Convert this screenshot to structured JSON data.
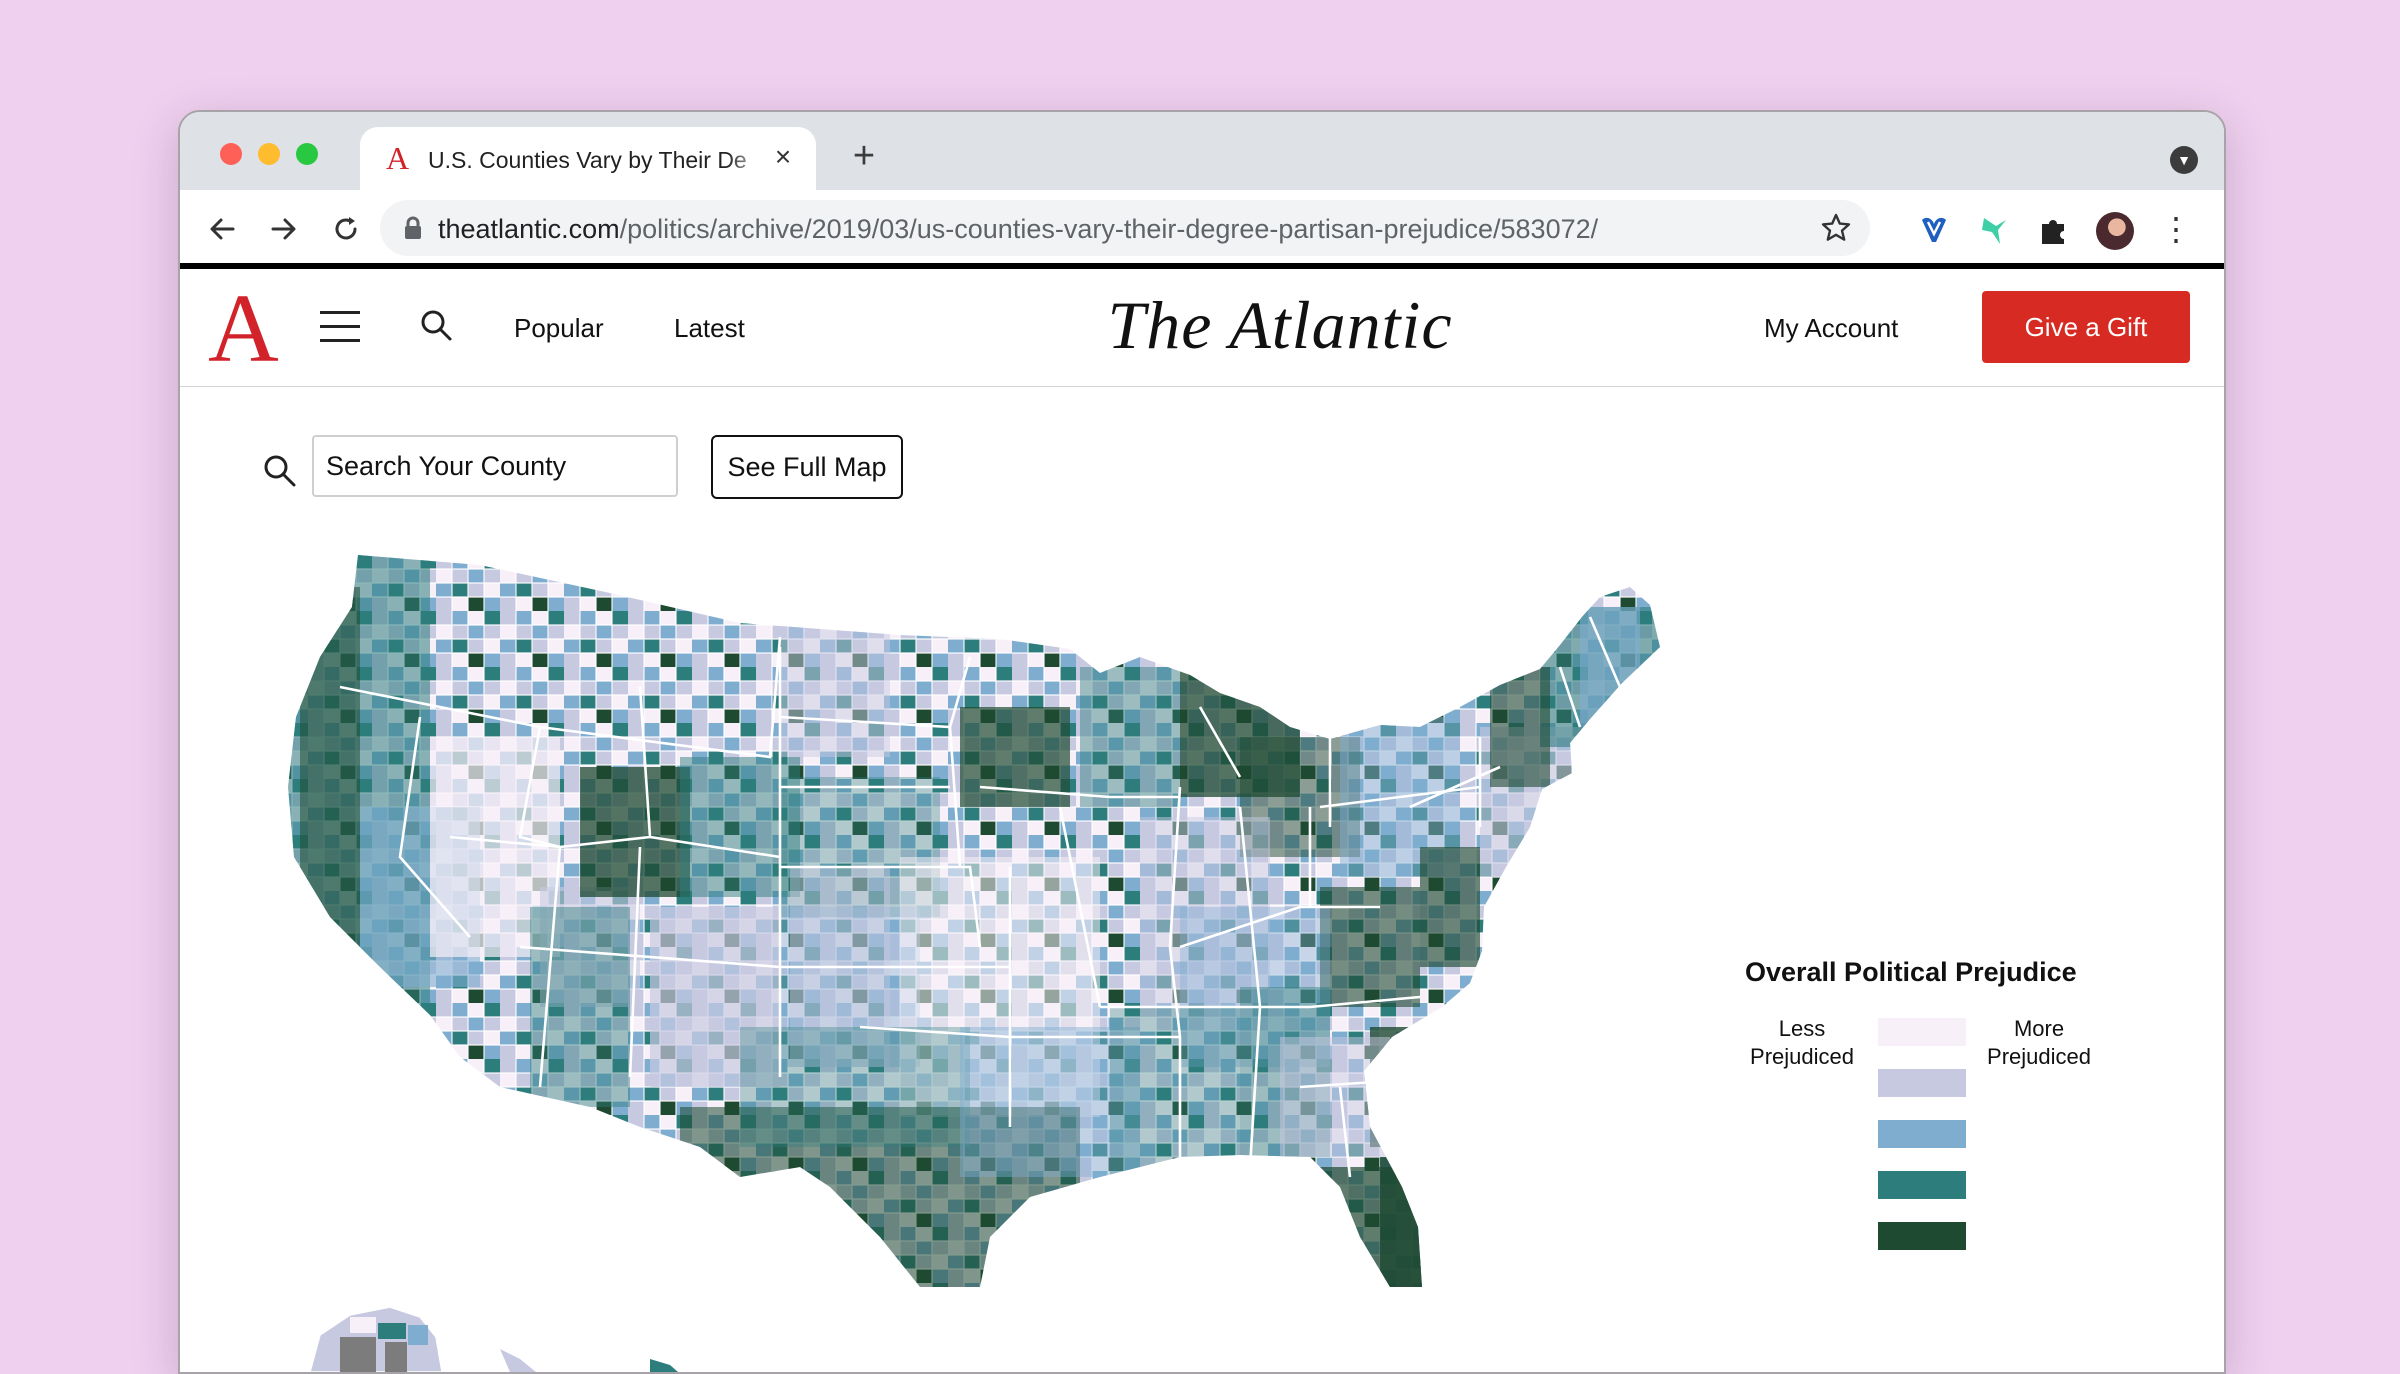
{
  "browser": {
    "tab_title": "U.S. Counties Vary by Their De",
    "tab_favicon": "A",
    "url_host": "theatlantic.com",
    "url_path": "/politics/archive/2019/03/us-counties-vary-their-degree-partisan-prejudice/583072/"
  },
  "header": {
    "brand_mark": "A",
    "nav": [
      "Popular",
      "Latest"
    ],
    "logo": "The Atlantic",
    "account": "My Account",
    "gift_button": "Give a Gift"
  },
  "map_controls": {
    "search_placeholder": "Search Your County",
    "full_map_button": "See Full Map"
  },
  "legend": {
    "title": "Overall Political Prejudice",
    "left_label": "Less Prejudiced",
    "right_label": "More Prejudiced",
    "colors": [
      "#f8f0f8",
      "#c7c9e1",
      "#7fadd0",
      "#2e7d7d",
      "#1e4a32"
    ]
  },
  "map_colors": {
    "level1": "#f8f0f8",
    "level2": "#c7c9e1",
    "level3": "#7fadd0",
    "level4": "#2e7d7d",
    "level5": "#1e4a32",
    "no_data": "#7c7c7c"
  }
}
